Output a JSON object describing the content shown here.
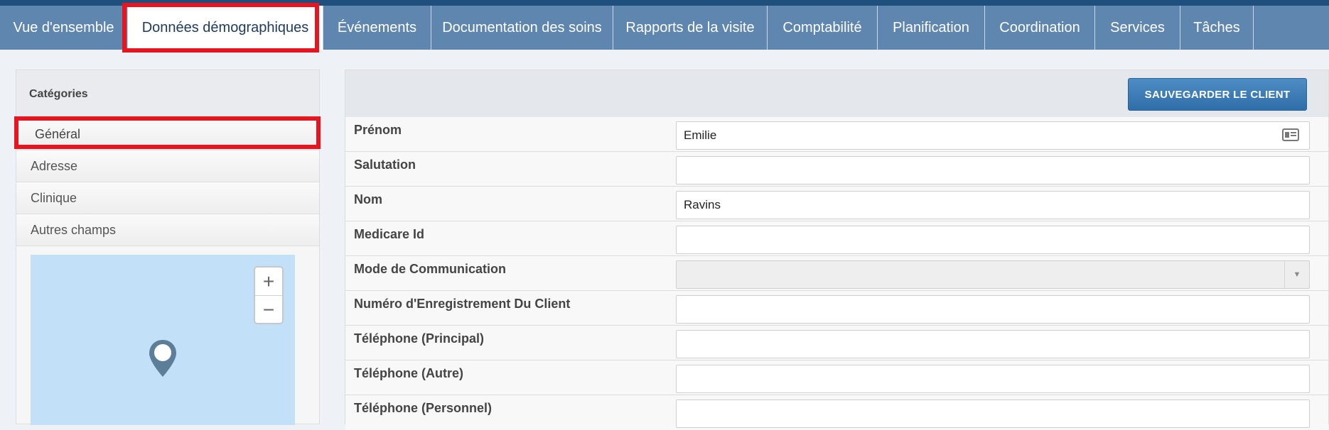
{
  "tabs": [
    {
      "label": "Vue d'ensemble",
      "active": false
    },
    {
      "label": "Données démographiques",
      "active": true
    },
    {
      "label": "Événements",
      "active": false
    },
    {
      "label": "Documentation des soins",
      "active": false
    },
    {
      "label": "Rapports de la visite",
      "active": false
    },
    {
      "label": "Comptabilité",
      "active": false
    },
    {
      "label": "Planification",
      "active": false
    },
    {
      "label": "Coordination",
      "active": false
    },
    {
      "label": "Services",
      "active": false
    },
    {
      "label": "Tâches",
      "active": false
    }
  ],
  "sidebar": {
    "title": "Catégories",
    "items": [
      {
        "label": "Général",
        "selected": true
      },
      {
        "label": "Adresse",
        "selected": false
      },
      {
        "label": "Clinique",
        "selected": false
      },
      {
        "label": "Autres champs",
        "selected": false
      }
    ],
    "map": {
      "zoom_in": "+",
      "zoom_out": "−"
    }
  },
  "main": {
    "save_button": "SAUVEGARDER LE CLIENT",
    "fields": [
      {
        "label": "Prénom",
        "value": "Emilie",
        "type": "text-with-icon"
      },
      {
        "label": "Salutation",
        "value": "",
        "type": "text"
      },
      {
        "label": "Nom",
        "value": "Ravins",
        "type": "text"
      },
      {
        "label": "Medicare Id",
        "value": "",
        "type": "text"
      },
      {
        "label": "Mode de Communication",
        "value": "",
        "type": "select"
      },
      {
        "label": "Numéro d'Enregistrement Du Client",
        "value": "",
        "type": "text"
      },
      {
        "label": "Téléphone (Principal)",
        "value": "",
        "type": "text"
      },
      {
        "label": "Téléphone (Autre)",
        "value": "",
        "type": "text"
      },
      {
        "label": "Téléphone (Personnel)",
        "value": "",
        "type": "text"
      }
    ]
  },
  "icons": {
    "contact_card": "contact-card-icon",
    "map_pin": "map-pin-icon",
    "dropdown": "chevron-down-icon"
  },
  "colors": {
    "tabbar": "#5f86ae",
    "highlight": "#e5161f",
    "save_button": "#3b7bb6",
    "map": "#c3e0f9"
  }
}
